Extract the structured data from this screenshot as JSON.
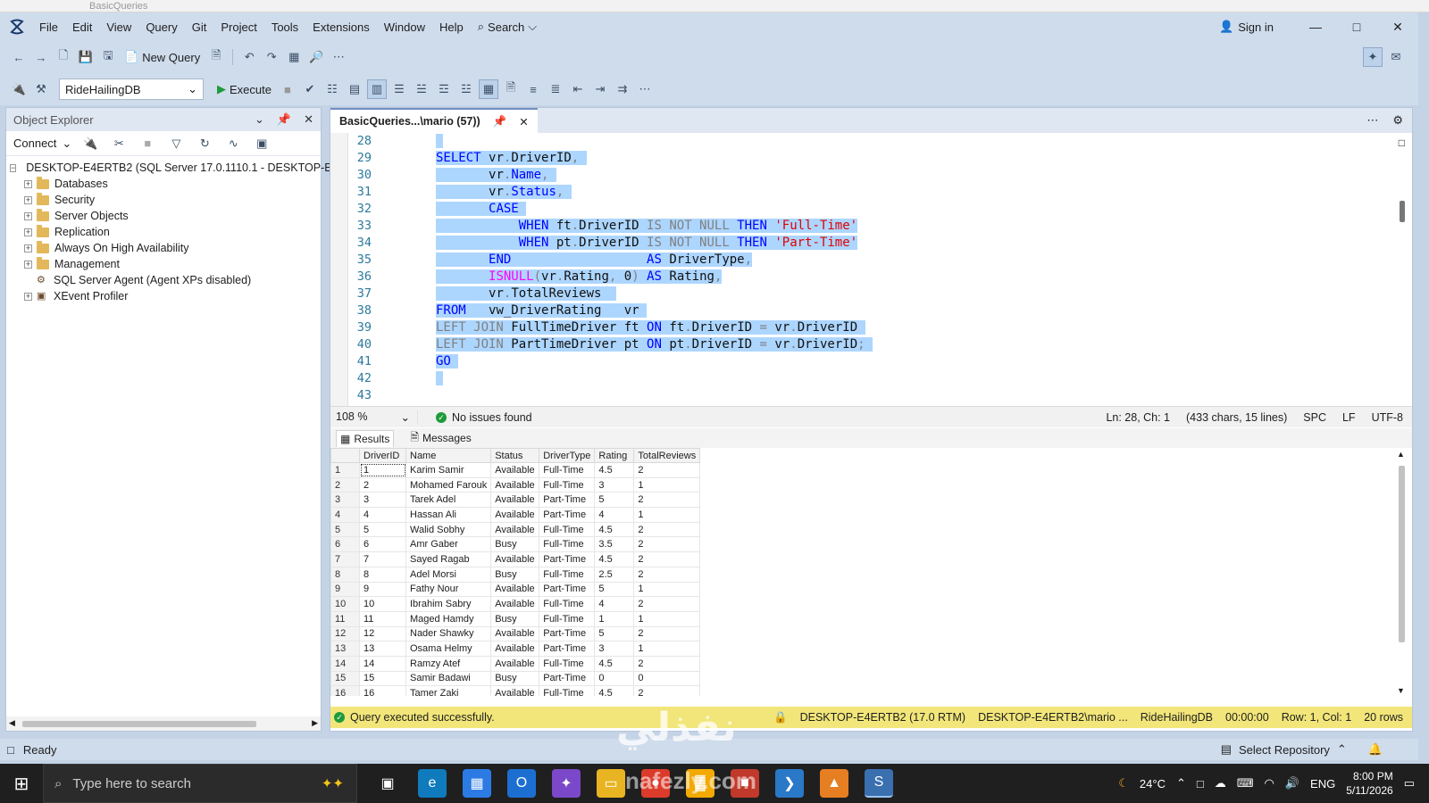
{
  "window": {
    "title": "BasicQueries"
  },
  "menu": {
    "items": [
      "File",
      "Edit",
      "View",
      "Query",
      "Git",
      "Project",
      "Tools",
      "Extensions",
      "Window",
      "Help"
    ],
    "search_label": "Search",
    "signin_label": "Sign in"
  },
  "toolbar": {
    "new_query_label": "New Query",
    "database": "RideHailingDB",
    "execute_label": "Execute"
  },
  "object_explorer": {
    "title": "Object Explorer",
    "connect_label": "Connect",
    "server": "DESKTOP-E4ERTB2 (SQL Server 17.0.1110.1 - DESKTOP-E4",
    "nodes": [
      "Databases",
      "Security",
      "Server Objects",
      "Replication",
      "Always On High Availability",
      "Management",
      "SQL Server Agent (Agent XPs disabled)",
      "XEvent Profiler"
    ]
  },
  "editor": {
    "tab_label": "BasicQueries...\\mario (57))",
    "zoom": "108 %",
    "issues": "No issues found",
    "position": "Ln: 28, Ch: 1",
    "selection_info": "(433 chars, 15 lines)",
    "whitespace": "SPC",
    "line_ending": "LF",
    "encoding": "UTF-8",
    "line_numbers": [
      "28",
      "29",
      "30",
      "31",
      "32",
      "33",
      "34",
      "35",
      "36",
      "37",
      "38",
      "39",
      "40",
      "41",
      "42",
      "43"
    ]
  },
  "results": {
    "tab_results": "Results",
    "tab_messages": "Messages",
    "columns": [
      "DriverID",
      "Name",
      "Status",
      "DriverType",
      "Rating",
      "TotalReviews"
    ],
    "rows": [
      [
        "1",
        "1",
        "Karim Samir",
        "Available",
        "Full-Time",
        "4.5",
        "2"
      ],
      [
        "2",
        "2",
        "Mohamed Farouk",
        "Available",
        "Full-Time",
        "3",
        "1"
      ],
      [
        "3",
        "3",
        "Tarek Adel",
        "Available",
        "Part-Time",
        "5",
        "2"
      ],
      [
        "4",
        "4",
        "Hassan Ali",
        "Available",
        "Part-Time",
        "4",
        "1"
      ],
      [
        "5",
        "5",
        "Walid Sobhy",
        "Available",
        "Full-Time",
        "4.5",
        "2"
      ],
      [
        "6",
        "6",
        "Amr Gaber",
        "Busy",
        "Full-Time",
        "3.5",
        "2"
      ],
      [
        "7",
        "7",
        "Sayed Ragab",
        "Available",
        "Part-Time",
        "4.5",
        "2"
      ],
      [
        "8",
        "8",
        "Adel Morsi",
        "Busy",
        "Full-Time",
        "2.5",
        "2"
      ],
      [
        "9",
        "9",
        "Fathy Nour",
        "Available",
        "Part-Time",
        "5",
        "1"
      ],
      [
        "10",
        "10",
        "Ibrahim Sabry",
        "Available",
        "Full-Time",
        "4",
        "2"
      ],
      [
        "11",
        "11",
        "Maged Hamdy",
        "Busy",
        "Full-Time",
        "1",
        "1"
      ],
      [
        "12",
        "12",
        "Nader Shawky",
        "Available",
        "Part-Time",
        "5",
        "2"
      ],
      [
        "13",
        "13",
        "Osama Helmy",
        "Available",
        "Part-Time",
        "3",
        "1"
      ],
      [
        "14",
        "14",
        "Ramzy Atef",
        "Available",
        "Full-Time",
        "4.5",
        "2"
      ],
      [
        "15",
        "15",
        "Samir Badawi",
        "Busy",
        "Part-Time",
        "0",
        "0"
      ],
      [
        "16",
        "16",
        "Tamer Zaki",
        "Available",
        "Full-Time",
        "4.5",
        "2"
      ]
    ],
    "status": "Query executed successfully.",
    "server": "DESKTOP-E4ERTB2 (17.0 RTM)",
    "user": "DESKTOP-E4ERTB2\\mario ...",
    "database": "RideHailingDB",
    "elapsed": "00:00:00",
    "rowcol": "Row: 1, Col: 1",
    "rowcount": "20 rows"
  },
  "statusbar": {
    "ready": "Ready",
    "repo": "Select Repository"
  },
  "taskbar": {
    "search_placeholder": "Type here to search",
    "weather": "24°C",
    "lang": "ENG",
    "time": "8:00 PM",
    "date": "5/11/2026"
  },
  "watermark": {
    "arabic": "نفذلي",
    "site": "nafezly.com"
  },
  "colors": {
    "selection": "#add6ff",
    "keyword": "#0000ff",
    "string": "#e00000",
    "status_ok": "#f2e67a",
    "chrome": "#cfdcec"
  }
}
